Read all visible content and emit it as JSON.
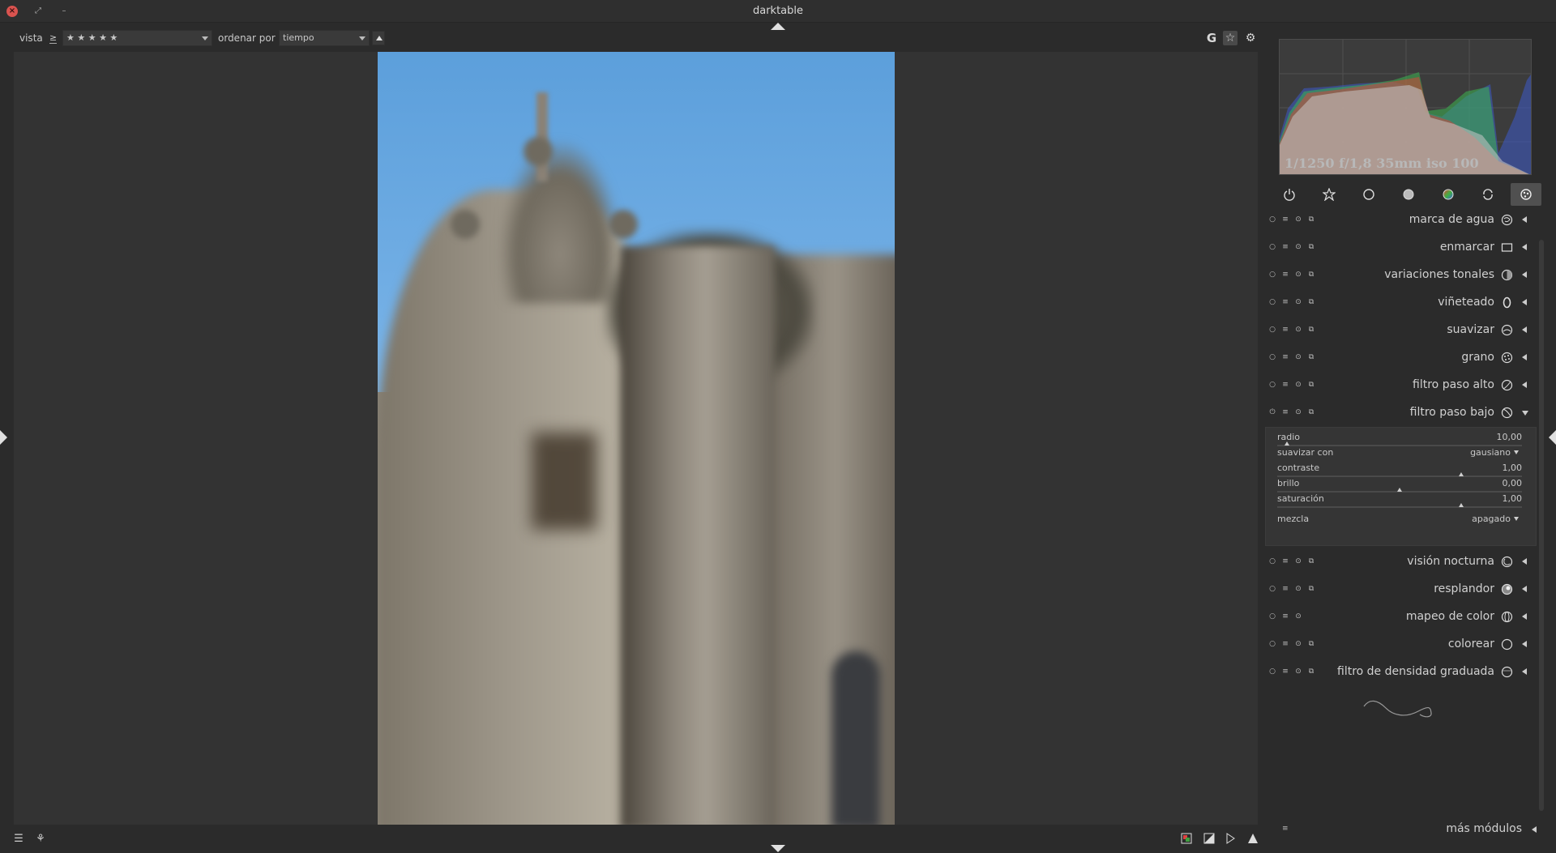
{
  "window": {
    "title": "darktable",
    "close_glyph": "×",
    "restore_glyph": "⤢",
    "minimize_glyph": "–"
  },
  "topbar": {
    "view_label": "vista",
    "rating_op": "≥",
    "rating_value": "★ ★ ★ ★ ★",
    "sort_label": "ordenar por",
    "sort_value": "tiempo",
    "right_icons": [
      "G",
      "☆",
      "⚙"
    ]
  },
  "histogram": {
    "exif": "1/1250 f/1,8 35mm iso 100"
  },
  "module_groups": [
    "power-icon",
    "favorite-star-icon",
    "basic-circle-icon",
    "tone-circle-icon",
    "color-circle-icon",
    "correct-icon",
    "effects-icon"
  ],
  "modules": [
    {
      "name": "marca de agua",
      "icon": "watermark-icon",
      "expanded": false
    },
    {
      "name": "enmarcar",
      "icon": "frame-icon",
      "expanded": false
    },
    {
      "name": "variaciones tonales",
      "icon": "split-toning-icon",
      "expanded": false
    },
    {
      "name": "viñeteado",
      "icon": "vignette-icon",
      "expanded": false
    },
    {
      "name": "suavizar",
      "icon": "soften-icon",
      "expanded": false
    },
    {
      "name": "grano",
      "icon": "grain-icon",
      "expanded": false
    },
    {
      "name": "filtro paso alto",
      "icon": "highpass-icon",
      "expanded": false
    },
    {
      "name": "filtro paso bajo",
      "icon": "lowpass-icon",
      "expanded": true
    },
    {
      "name": "visión nocturna",
      "icon": "lowlight-icon",
      "expanded": false
    },
    {
      "name": "resplandor",
      "icon": "bloom-icon",
      "expanded": false
    },
    {
      "name": "mapeo de color",
      "icon": "colormapping-icon",
      "expanded": false
    },
    {
      "name": "colorear",
      "icon": "colorize-icon",
      "expanded": false
    },
    {
      "name": "filtro de densidad graduada",
      "icon": "graduated-density-icon",
      "expanded": false
    }
  ],
  "lowpass": {
    "radio_label": "radio",
    "radio_value": "10,00",
    "radio_pos": 0.04,
    "blur_label": "suavizar con",
    "blur_value": "gausiano",
    "contrast_label": "contraste",
    "contrast_value": "1,00",
    "contrast_pos": 0.75,
    "brightness_label": "brillo",
    "brightness_value": "0,00",
    "brightness_pos": 0.5,
    "saturation_label": "saturación",
    "saturation_value": "1,00",
    "saturation_pos": 0.75,
    "blend_label": "mezcla",
    "blend_value": "apagado"
  },
  "more_modules": {
    "label": "más módulos"
  },
  "bottombar": {
    "menu_glyph": "☰",
    "colorpick_glyph": "⚘"
  },
  "colors": {
    "accent": "#d9534f",
    "panel_bg": "#2b2b2b",
    "center_bg": "#333333"
  }
}
